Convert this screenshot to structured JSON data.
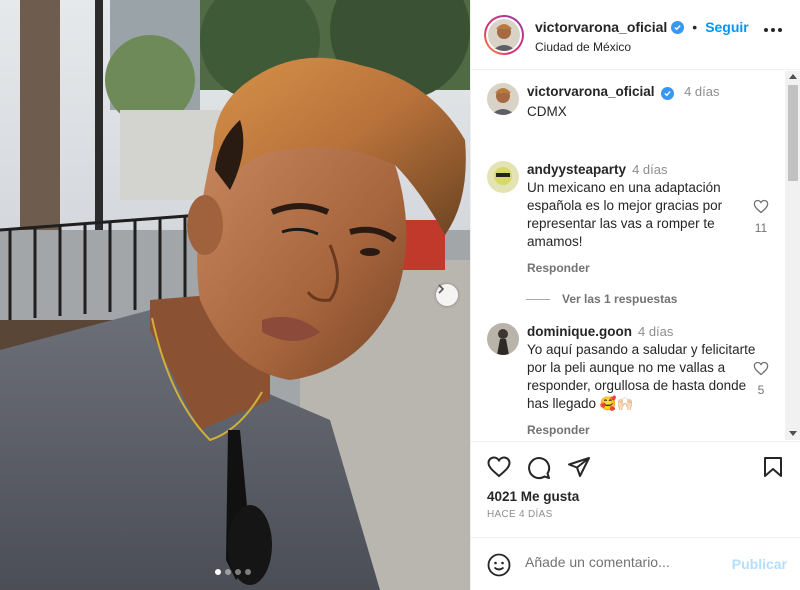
{
  "post": {
    "author": "victorvarona_oficial",
    "follow_label": "Seguir",
    "separator": "•",
    "location": "Ciudad de México",
    "caption": "CDMX",
    "caption_time": "4 días",
    "carousel": {
      "slides": 4,
      "active_index": 0
    }
  },
  "comments": [
    {
      "username": "andyysteaparty",
      "time": "4 días",
      "text": "Un mexicano en una adaptación española es lo mejor gracias por representar las vas a romper te amamos!",
      "likes": "11",
      "reply_label": "Responder",
      "view_replies": "Ver las 1 respuestas"
    },
    {
      "username": "dominique.goon",
      "time": "4 días",
      "text": "Yo aquí pasando a saludar y felicitarte por la peli aunque no me vallas a responder, orgullosa de hasta donde has llegado 🥰🙌🏻",
      "likes": "5",
      "reply_label": "Responder"
    }
  ],
  "engagement": {
    "likes_text": "4021 Me gusta",
    "date_text": "HACE 4 DÍAS"
  },
  "comment_box": {
    "placeholder": "Añade un comentario...",
    "publish_label": "Publicar"
  },
  "colors": {
    "accent": "#0095f6",
    "publish_disabled": "#b2dffc",
    "verified": "#3897f0"
  },
  "icons": [
    "heart-icon",
    "comment-icon",
    "share-icon",
    "bookmark-icon",
    "emoji-icon",
    "verified-badge-icon",
    "more-options-icon",
    "chevron-right-icon"
  ]
}
